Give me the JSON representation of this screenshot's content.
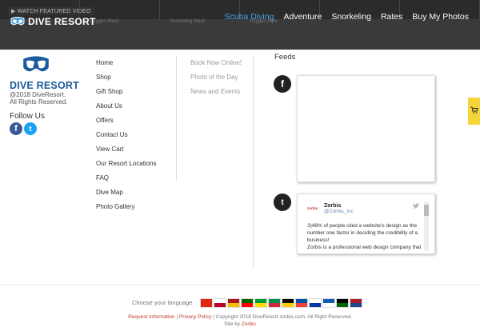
{
  "header": {
    "video_label": "WATCH FEATURED VIDEO",
    "hero_captions": [
      "",
      "Oxygen Mask",
      "Snorkeling Mask",
      "Oxygen Pipe",
      "",
      ""
    ],
    "logo_text": "DIVE RESORT",
    "nav": [
      {
        "label": "Scuba Diving",
        "active": true
      },
      {
        "label": "Adventure",
        "active": false
      },
      {
        "label": "Snorkeling",
        "active": false
      },
      {
        "label": "Rates",
        "active": false
      },
      {
        "label": "Buy My Photos",
        "active": false
      }
    ],
    "accent_color": "#4aa3df",
    "background_color": "#3a3a3a"
  },
  "footer_brand": {
    "name": "DIVE RESORT",
    "copyright_line1": "@2018 DiveResort.",
    "copyright_line2": "All Rights Reserved.",
    "follow_label": "Follow Us",
    "social": [
      {
        "icon": "facebook-icon",
        "glyph": "f"
      },
      {
        "icon": "twitter-icon",
        "glyph": "t"
      }
    ]
  },
  "links_primary": [
    "Home",
    "Shop",
    "Gift Shop",
    "About Us",
    "Offers",
    "Contact Us",
    "View Cart",
    "Our Resort Locations",
    "FAQ",
    "Dive Map",
    "Photo Gallery"
  ],
  "links_secondary": [
    "Book Now Online!",
    "Photo of the Day",
    "News and Events"
  ],
  "feeds": {
    "title": "Feeds",
    "facebook_glyph": "f",
    "twitter_glyph": "t",
    "tweet": {
      "logo": "zorbis",
      "name": "Zorbis",
      "handle": "@Zorbis_Inc",
      "text": "3)48% of people cited a website's design as the number one factor in deciding the credibility of a business!",
      "text_more": "Zorbis is a professional web design company that"
    }
  },
  "cart_tab": {
    "icon": "cart-icon",
    "glyph": "🛒"
  },
  "language": {
    "label": "Choose your language",
    "flags": [
      {
        "icon": "flag-china-icon",
        "colors": [
          "#de2910",
          "#de2910"
        ]
      },
      {
        "icon": "flag-japan-icon",
        "colors": [
          "#ffffff",
          "#bc002d"
        ]
      },
      {
        "icon": "flag-spain-icon",
        "colors": [
          "#aa151b",
          "#f1bf00"
        ]
      },
      {
        "icon": "flag-portugal-icon",
        "colors": [
          "#006600",
          "#ff0000"
        ]
      },
      {
        "icon": "flag-brazil-icon",
        "colors": [
          "#009c3b",
          "#ffdf00"
        ]
      },
      {
        "icon": "flag-italy-icon",
        "colors": [
          "#009246",
          "#ce2b37"
        ]
      },
      {
        "icon": "flag-germany-icon",
        "colors": [
          "#000000",
          "#ffce00"
        ]
      },
      {
        "icon": "flag-france-icon",
        "colors": [
          "#0055a4",
          "#ef4135"
        ]
      },
      {
        "icon": "flag-russia-icon",
        "colors": [
          "#ffffff",
          "#0039a6"
        ]
      },
      {
        "icon": "flag-greece-icon",
        "colors": [
          "#0d5eaf",
          "#ffffff"
        ]
      },
      {
        "icon": "flag-kenya-icon",
        "colors": [
          "#000000",
          "#006600"
        ]
      },
      {
        "icon": "flag-netherlands-icon",
        "colors": [
          "#ae1c28",
          "#21468b"
        ]
      }
    ]
  },
  "legal": {
    "request_info": "Request Information",
    "sep": " | ",
    "privacy": "Privacy Policy",
    "copyright": " | Copyright 2018 DiveResort.zorbis.com. All Right Reserved.",
    "site_by_label": "Site by ",
    "site_by_link": "Zorbis"
  }
}
